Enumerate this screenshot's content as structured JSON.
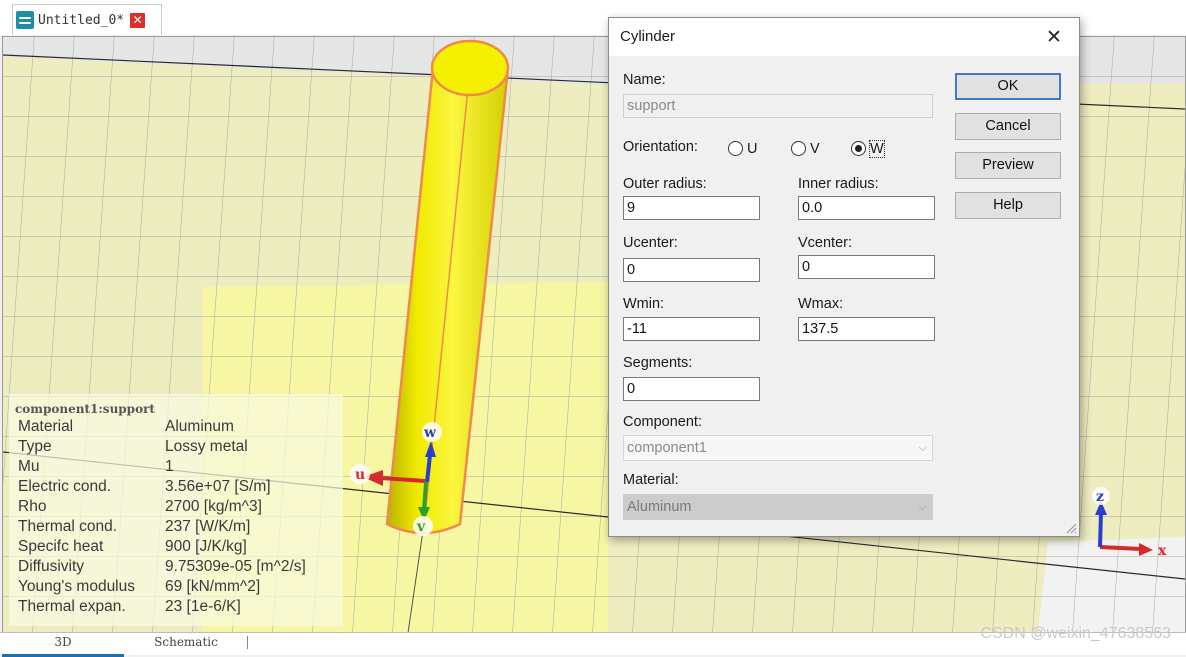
{
  "doc_tab": {
    "title": "Untitled_0*",
    "close": "✕"
  },
  "axes": {
    "u": "u",
    "v": "v",
    "w": "w",
    "x": "x",
    "z": "z"
  },
  "props": {
    "title": "component1:support",
    "rows": [
      {
        "key": "Material",
        "value": "Aluminum"
      },
      {
        "key": "Type",
        "value": "Lossy metal"
      },
      {
        "key": "Mu",
        "value": "1"
      },
      {
        "key": "Electric cond.",
        "value": "3.56e+07 [S/m]"
      },
      {
        "key": "Rho",
        "value": "2700 [kg/m^3]"
      },
      {
        "key": "Thermal cond.",
        "value": "237 [W/K/m]"
      },
      {
        "key": "Specifc heat",
        "value": "900 [J/K/kg]"
      },
      {
        "key": "Diffusivity",
        "value": "9.75309e-05 [m^2/s]"
      },
      {
        "key": "Young's modulus",
        "value": "69 [kN/mm^2]"
      },
      {
        "key": "Thermal expan.",
        "value": "23 [1e-6/K]"
      }
    ]
  },
  "bottom_tabs": {
    "tab_3d": "3D",
    "tab_schematic": "Schematic"
  },
  "watermark": "CSDN @weixin_47638563",
  "dialog": {
    "title": "Cylinder",
    "close": "✕",
    "name_label": "Name:",
    "name_value": "support",
    "orientation_label": "Orientation:",
    "orientation_options": [
      "U",
      "V",
      "W"
    ],
    "orientation_selected": "W",
    "outer_radius_label": "Outer radius:",
    "outer_radius": "9",
    "inner_radius_label": "Inner radius:",
    "inner_radius": "0.0",
    "ucenter_label": "Ucenter:",
    "ucenter": "0",
    "vcenter_label": "Vcenter:",
    "vcenter": "0",
    "wmin_label": "Wmin:",
    "wmin": "-11",
    "wmax_label": "Wmax:",
    "wmax": "137.5",
    "segments_label": "Segments:",
    "segments": "0",
    "component_label": "Component:",
    "component": "component1",
    "material_label": "Material:",
    "material": "Aluminum",
    "buttons": {
      "ok": "OK",
      "cancel": "Cancel",
      "preview": "Preview",
      "help": "Help"
    }
  },
  "colors": {
    "plane": "#ededc0",
    "highlight": "#f6f6a3",
    "grid": "#a8a8a8",
    "cylinder": "#f5f000",
    "cylinder_edge": "#f08a4b",
    "axis_u": "#d42a2a",
    "axis_v": "#2ba02b",
    "axis_w": "#2a3fd0",
    "button_focus": "#3e7bc9"
  }
}
